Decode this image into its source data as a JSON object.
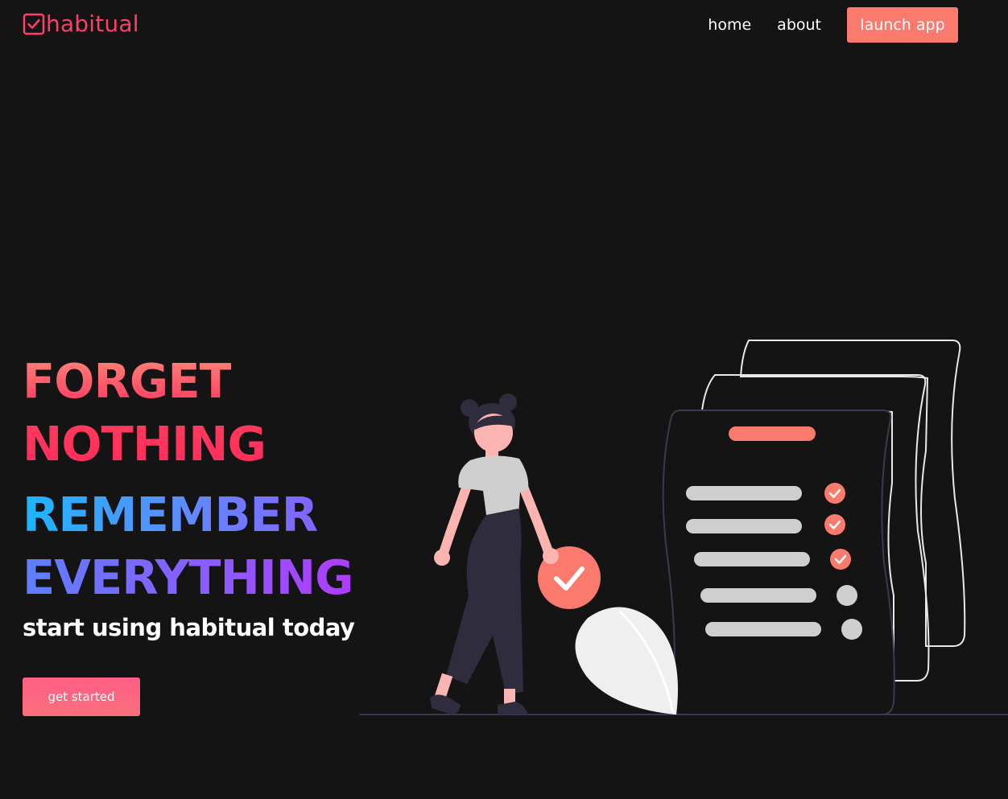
{
  "brand": {
    "name": "habitual",
    "color": "#ff3e6a",
    "icon": "checkbox-icon"
  },
  "nav": {
    "links": [
      {
        "label": "home"
      },
      {
        "label": "about"
      }
    ],
    "cta_label": "launch app",
    "cta_color": "#fa7a6e"
  },
  "hero": {
    "line1": "FORGET",
    "line2": "NOTHING",
    "line3": "REMEMBER",
    "line4": "EVERYTHING",
    "tagline": "start using habitual today",
    "cta_label": "get started"
  },
  "illustration": {
    "name": "woman-with-checklist",
    "checked_items": 3,
    "total_items": 5,
    "accent": "#fa7a6e"
  },
  "colors": {
    "background": "#141414",
    "text": "#ffffff"
  }
}
